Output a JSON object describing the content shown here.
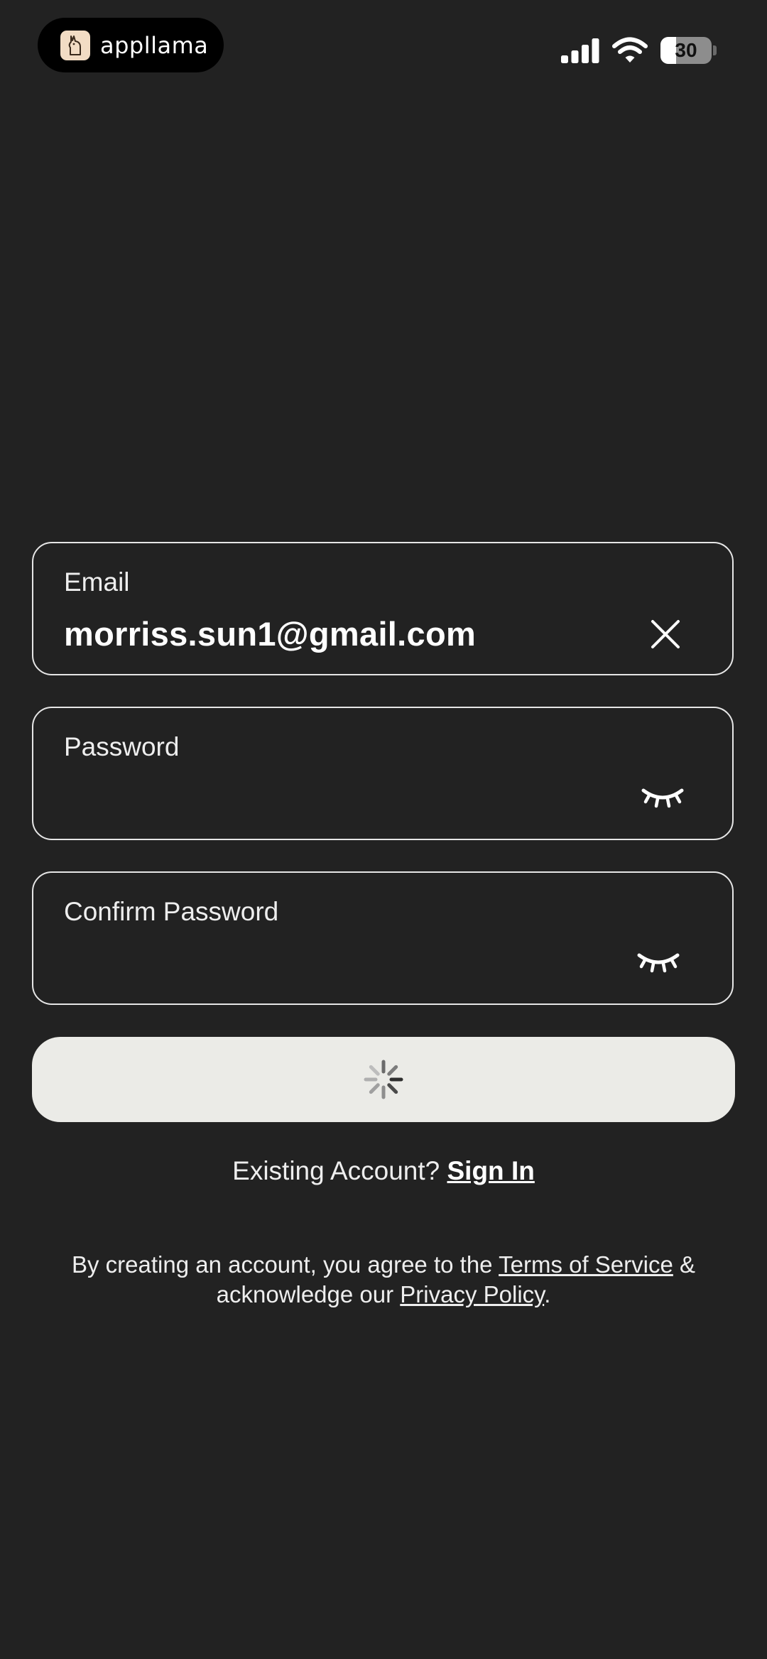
{
  "status_bar": {
    "app_name": "appllama",
    "battery": "30",
    "battery_level": 0.3,
    "icons": [
      "appllama-logo-icon",
      "cellular-signal-icon",
      "wifi-icon",
      "battery-icon"
    ]
  },
  "form": {
    "email": {
      "label": "Email",
      "value": "morriss.sun1@gmail.com",
      "icon": "clear-icon"
    },
    "password": {
      "label": "Password",
      "value": "",
      "icon": "eye-closed-icon"
    },
    "confirm_password": {
      "label": "Confirm Password",
      "value": "",
      "icon": "eye-closed-icon"
    },
    "submit": {
      "state": "loading",
      "icon": "loading-spinner-icon"
    }
  },
  "sign_in_prompt": {
    "text": "Existing Account?",
    "link": "Sign In"
  },
  "legal": {
    "line1_prefix": "By creating an account, you agree to the",
    "terms_link": "Terms of Service",
    "line1_suffix": "&",
    "line2_prefix": "acknowledge our",
    "privacy_link": "Privacy Policy",
    "line2_suffix": "."
  },
  "colors": {
    "background": "#222222",
    "button": "#ebebe7",
    "field_border": "#e6e6e6"
  }
}
